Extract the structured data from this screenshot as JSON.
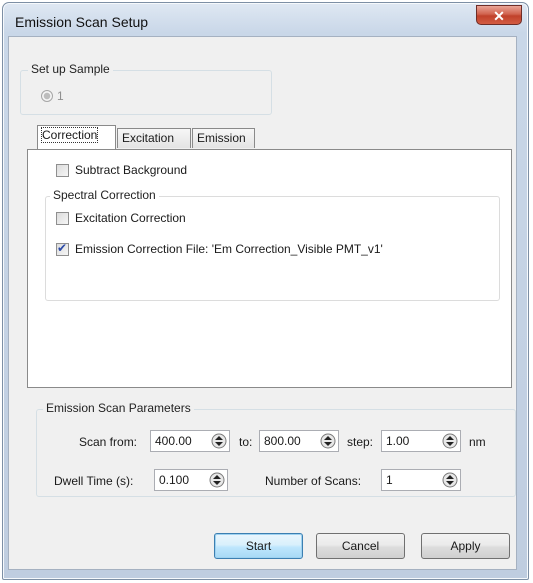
{
  "window": {
    "title": "Emission Scan Setup",
    "close_icon": "close-icon"
  },
  "sample_group": {
    "label": "Set up Sample",
    "radio_value": "1"
  },
  "tabs": [
    {
      "label": "Correction",
      "active": true
    },
    {
      "label": "Excitation",
      "active": false
    },
    {
      "label": "Emission",
      "active": false
    }
  ],
  "correction": {
    "subtract_background": {
      "label": "Subtract Background",
      "checked": false
    },
    "spectral_group_label": "Spectral Correction",
    "excitation_correction": {
      "label": "Excitation Correction",
      "checked": false
    },
    "emission_correction": {
      "label": "Emission Correction File: 'Em Correction_Visible PMT_v1'",
      "checked": true
    }
  },
  "scan_params": {
    "group_label": "Emission Scan Parameters",
    "scan_from_label": "Scan from:",
    "scan_from_value": "400.00",
    "to_label": "to:",
    "to_value": "800.00",
    "step_label": "step:",
    "step_value": "1.00",
    "unit": "nm",
    "dwell_label": "Dwell Time (s):",
    "dwell_value": "0.100",
    "num_scans_label": "Number of Scans:",
    "num_scans_value": "1"
  },
  "buttons": {
    "start": "Start",
    "cancel": "Cancel",
    "apply": "Apply"
  }
}
